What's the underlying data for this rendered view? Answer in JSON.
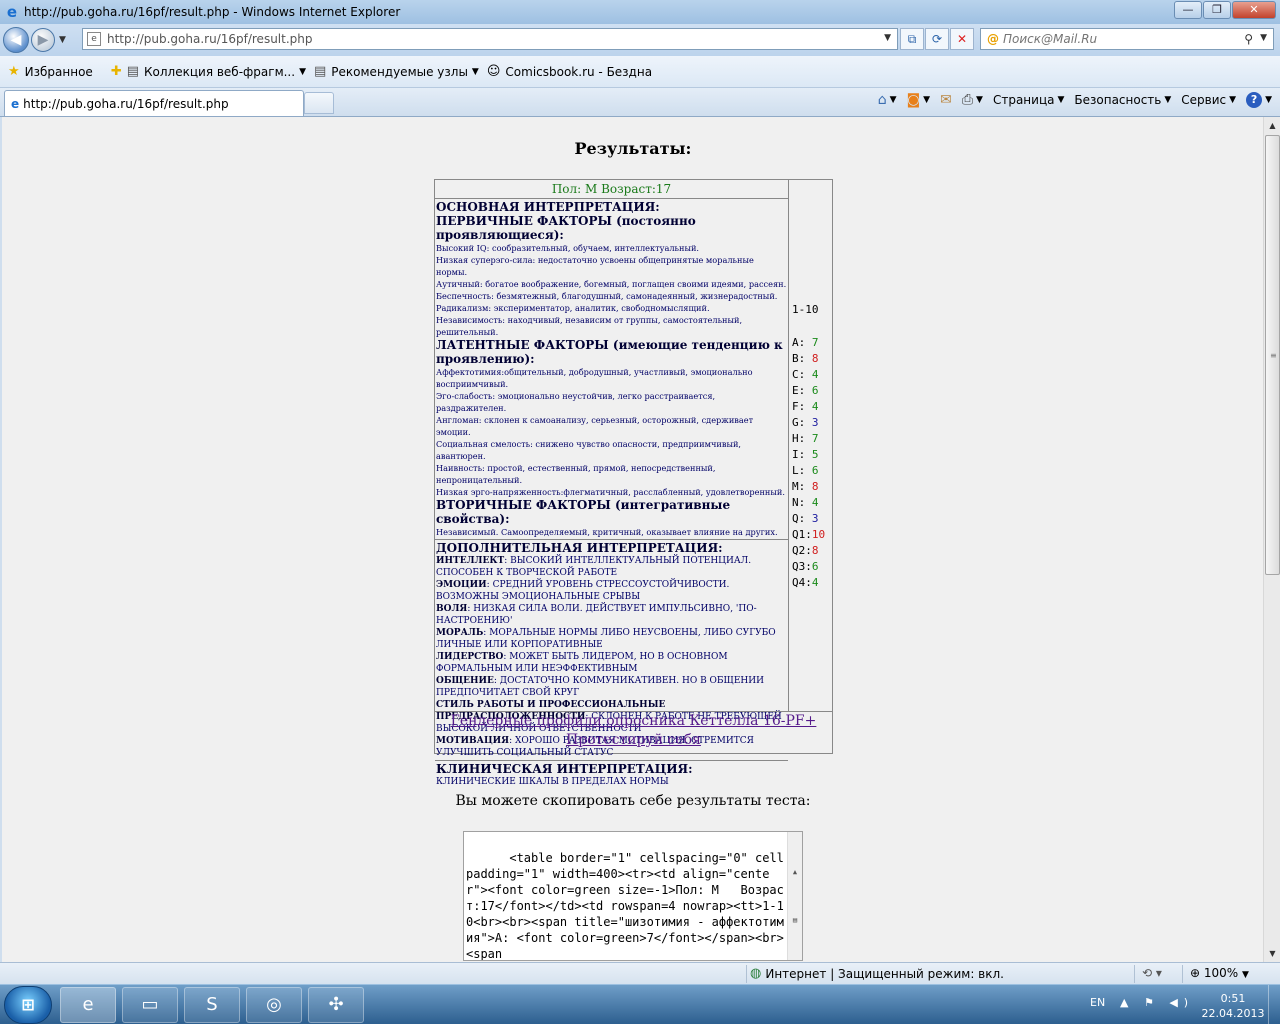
{
  "window": {
    "title": "http://pub.goha.ru/16pf/result.php - Windows Internet Explorer",
    "minimize": "—",
    "restore": "❐",
    "close": "✕"
  },
  "nav": {
    "back": "◀",
    "forward": "▶",
    "address": "http://pub.goha.ru/16pf/result.php",
    "search_placeholder": "Поиск@Mail.Ru"
  },
  "favorites": {
    "label": "Избранное",
    "items": [
      {
        "label": "Коллекция веб-фрагм..."
      },
      {
        "label": "Рекомендуемые узлы"
      },
      {
        "label": "Comicsbook.ru - Бездна"
      }
    ]
  },
  "tab": {
    "label": "http://pub.goha.ru/16pf/result.php"
  },
  "commands": {
    "page": "Страница",
    "safety": "Безопасность",
    "service": "Сервис",
    "help": "?"
  },
  "page": {
    "title": "Результаты:",
    "header": "Пол: М   Возраст:17",
    "basic": {
      "heading": "ОСНОВНАЯ ИНТЕРПРЕТАЦИЯ:",
      "primary_heading": "ПЕРВИЧНЫЕ ФАКТОРЫ (постоянно проявляющиеся):",
      "primary": [
        "Высокий IQ: сообразительный, обучаем, интеллектуальный.",
        "Низкая суперэго-сила: недостаточно усвоены общепринятые моральные нормы.",
        "Аутичный: богатое воображение, богемный, поглащен своими идеями, рассеян.",
        "Беспечность: безмятежный, благодушный, самонадеянный, жизнерадостный.",
        "Радикализм: экспериментатор, аналитик, свободномыслящий.",
        "Независимость: находчивый, независим от группы, самостоятельный, решительный."
      ],
      "latent_heading": "ЛАТЕНТНЫЕ ФАКТОРЫ (имеющие тенденцию к проявлению):",
      "latent": [
        "Аффектотимия:общительный, добродушный, участливый, эмоционально восприимчивый.",
        "Эго-слабость: эмоционально неустойчив, легко расстраивается, раздражителен.",
        "Англоман: склонен к самоанализу, серьезный, осторожный, сдерживает эмоции.",
        "Социальная смелость: снижено чувство опасности, предприимчивый, авантюрен.",
        "Наивность: простой, естественный, прямой, непосредственный, непроницательный.",
        "Низкая эрго-напряженность:флегматичный, расслабленный, удовлетворенный."
      ],
      "secondary_heading": "ВТОРИЧНЫЕ ФАКТОРЫ (интегративные свойства):",
      "secondary": "Независимый. Самоопределяемый, критичный, оказывает влияние на других."
    },
    "additional": {
      "heading": "ДОПОЛНИТЕЛЬНАЯ ИНТЕРПРЕТАЦИЯ:",
      "items": [
        {
          "k": "ИНТЕЛЛЕКТ",
          "v": ": ВЫСОКИЙ ИНТЕЛЛЕКТУАЛЬНЫЙ ПОТЕНЦИАЛ. СПОСОБЕН К ТВОРЧЕСКОЙ РАБОТЕ"
        },
        {
          "k": "ЭМОЦИИ",
          "v": ": СРЕДНИЙ УРОВЕНЬ СТРЕССОУСТОЙЧИВОСТИ. ВОЗМОЖНЫ ЭМОЦИОНАЛЬНЫЕ СРЫВЫ"
        },
        {
          "k": "ВОЛЯ",
          "v": ": НИЗКАЯ СИЛА ВОЛИ. ДЕЙСТВУЕТ ИМПУЛЬСИВНО, 'ПО-НАСТРОЕНИЮ'"
        },
        {
          "k": "МОРАЛЬ",
          "v": ": МОРАЛЬНЫЕ НОРМЫ ЛИБО НЕУСВОЕНЫ, ЛИБО СУГУБО ЛИЧНЫЕ ИЛИ КОРПОРАТИВНЫЕ"
        },
        {
          "k": "ЛИДЕРСТВО",
          "v": ": МОЖЕТ БЫТЬ ЛИДЕРОМ, НО В ОСНОВНОМ ФОРМАЛЬНЫМ ИЛИ НЕЭФФЕКТИВНЫМ"
        },
        {
          "k": "ОБЩЕНИЕ",
          "v": ": ДОСТАТОЧНО КОММУНИКАТИВЕН. НО В ОБЩЕНИИ ПРЕДПОЧИТАЕТ СВОЙ КРУГ"
        },
        {
          "k": "СТИЛЬ РАБОТЫ И ПРОФЕССИОНАЛЬНЫЕ ПРЕДРАСПОЛОЖЕННОСТИ",
          "v": ": СКЛОНЕН К РАБОТЕ НЕ ТРЕБУЮЩЕЙ ВЫСОКОЙ ЛИЧНОЙ ОТВЕТСТВЕННОСТИ"
        },
        {
          "k": "МОТИВАЦИЯ",
          "v": ": ХОРОШО РАЗВИТАЯ МОТИВАЦИЯ. СТРЕМИТСЯ УЛУЧШИТЬ СОЦИАЛЬНЫЙ СТАТУС"
        }
      ]
    },
    "clinical": {
      "heading": "КЛИНИЧЕСКАЯ ИНТЕРПРЕТАЦИЯ:",
      "text": "КЛИНИЧЕСКИЕ ШКАЛЫ В ПРЕДЕЛАХ НОРМЫ"
    },
    "scale": "1-10",
    "factors": [
      {
        "name": "A:",
        "value": "7",
        "color": "g"
      },
      {
        "name": "B:",
        "value": "8",
        "color": "r"
      },
      {
        "name": "C:",
        "value": "4",
        "color": "g"
      },
      {
        "name": "E:",
        "value": "6",
        "color": "g"
      },
      {
        "name": "F:",
        "value": "4",
        "color": "g"
      },
      {
        "name": "G:",
        "value": "3",
        "color": "b"
      },
      {
        "name": "H:",
        "value": "7",
        "color": "g"
      },
      {
        "name": "I:",
        "value": "5",
        "color": "g"
      },
      {
        "name": "L:",
        "value": "6",
        "color": "g"
      },
      {
        "name": "M:",
        "value": "8",
        "color": "r"
      },
      {
        "name": "N:",
        "value": "4",
        "color": "g"
      },
      {
        "name": "Q:",
        "value": "3",
        "color": "b"
      },
      {
        "name": "Q1:",
        "value": "10",
        "color": "r"
      },
      {
        "name": "Q2:",
        "value": "8",
        "color": "r"
      },
      {
        "name": "Q3:",
        "value": "6",
        "color": "g"
      },
      {
        "name": "Q4:",
        "value": "4",
        "color": "g"
      }
    ],
    "link1": "Гендерные профили опросника Кеттелла 16-PF+",
    "link2": "Протестируй себя",
    "copy_label": "Вы можете скопировать себе результаты теста:",
    "code": "<table border=\"1\" cellspacing=\"0\" cellpadding=\"1\" width=400><tr><td align=\"center\"><font color=green size=-1>Пол: М   Возраст:17</font></td><td rowspan=4 nowrap><tt>1-10<br><br><span title=\"шизотимия - аффектотимия\">A: <font color=green>7</font></span><br><span"
  },
  "status": {
    "zone": "Интернет | Защищенный режим: вкл.",
    "zoom": "100%"
  },
  "tray": {
    "lang": "EN",
    "time": "0:51",
    "date": "22.04.2013"
  },
  "colors": {
    "green": "#1a8a1a",
    "red": "#d02020",
    "blue": "#2020a0"
  }
}
